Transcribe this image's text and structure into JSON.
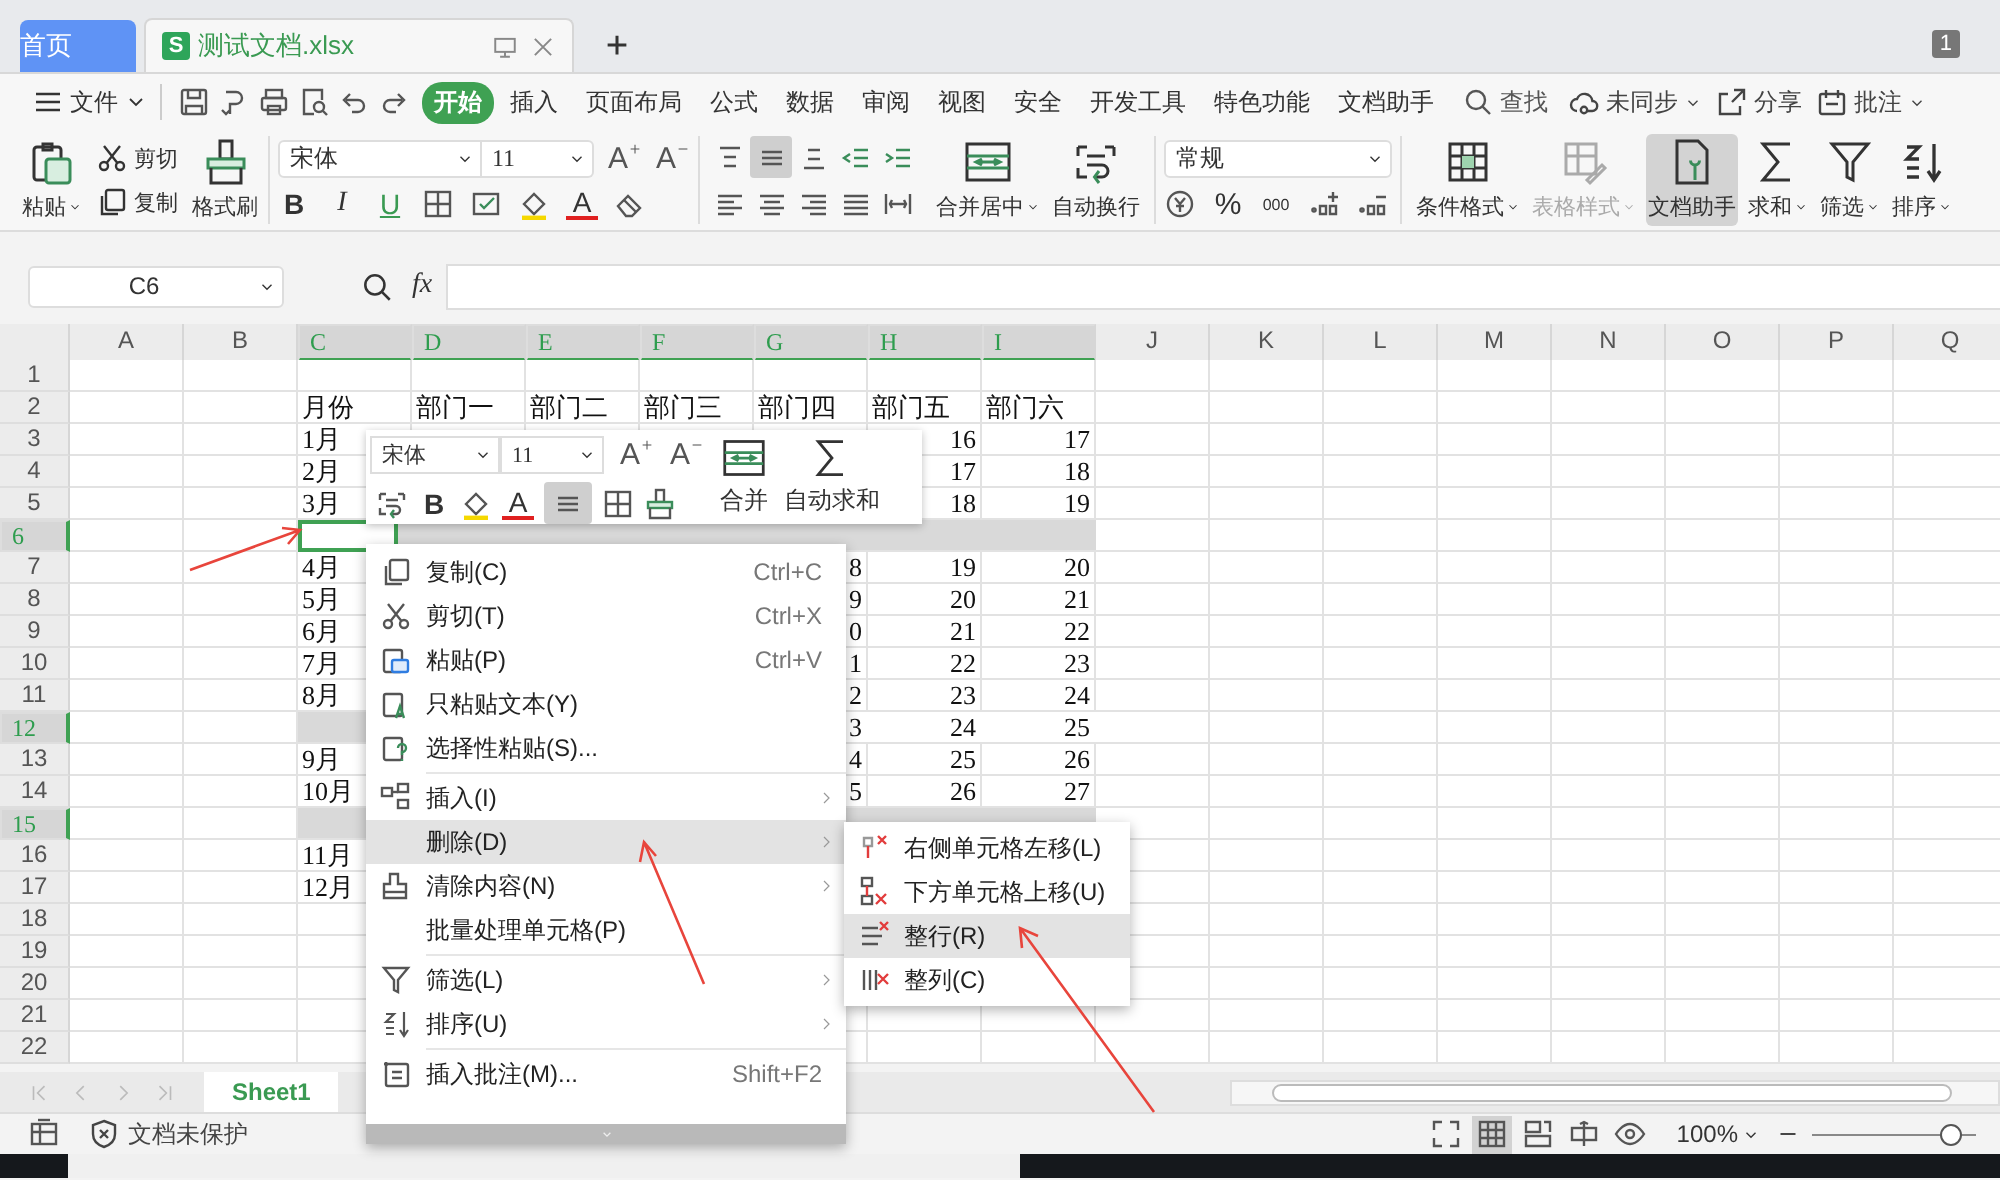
{
  "tabs": [
    {
      "kind": "home",
      "label": "首页",
      "selected": false
    },
    {
      "kind": "document",
      "label": "测试文档.xlsx",
      "icon_text": "S",
      "selected": true
    }
  ],
  "window_badge": "1",
  "menu": {
    "file": "文件",
    "tabs": [
      {
        "label": "开始",
        "selected": true
      },
      {
        "label": "插入",
        "selected": false
      },
      {
        "label": "页面布局",
        "selected": false
      },
      {
        "label": "公式",
        "selected": false
      },
      {
        "label": "数据",
        "selected": false
      },
      {
        "label": "审阅",
        "selected": false
      },
      {
        "label": "视图",
        "selected": false
      },
      {
        "label": "安全",
        "selected": false
      },
      {
        "label": "开发工具",
        "selected": false
      },
      {
        "label": "特色功能",
        "selected": false
      },
      {
        "label": "文档助手",
        "selected": false
      }
    ],
    "search": "查找",
    "actions": [
      {
        "kind": "sync",
        "label": "未同步",
        "dropdown": true
      },
      {
        "kind": "share",
        "label": "分享",
        "dropdown": false
      },
      {
        "kind": "comment",
        "label": "批注",
        "dropdown": true
      }
    ]
  },
  "ribbon": {
    "paste": "粘贴",
    "cut": "剪切",
    "copy": "复制",
    "format_painter": "格式刷",
    "font": "宋体",
    "font_size": "11",
    "grow_font": "A",
    "shrink_font": "A",
    "bold": "B",
    "italic": "I",
    "underline": "U",
    "font_color": "A",
    "alignment": [
      {
        "kind": "top",
        "selected": false
      },
      {
        "kind": "middle",
        "selected": true
      },
      {
        "kind": "bottom",
        "selected": false
      },
      {
        "kind": "outdent",
        "selected": false
      },
      {
        "kind": "indent",
        "selected": false
      },
      {
        "kind": "left",
        "selected": false
      },
      {
        "kind": "center",
        "selected": false
      },
      {
        "kind": "right",
        "selected": false
      },
      {
        "kind": "justify",
        "selected": false
      },
      {
        "kind": "distribute",
        "selected": false
      }
    ],
    "merge_buttons": [
      {
        "kind": "merge",
        "label": "合并居中",
        "dropdown": true,
        "disabled": false,
        "selected": false
      },
      {
        "kind": "wrap",
        "label": "自动换行",
        "dropdown": false,
        "disabled": false,
        "selected": false
      }
    ],
    "number_format": "常规",
    "percent": "%",
    "thousands": "000",
    "tool_buttons": [
      {
        "kind": "conditional",
        "label": "条件格式",
        "dropdown": true,
        "disabled": false,
        "selected": false
      },
      {
        "kind": "table-style",
        "label": "表格样式",
        "dropdown": true,
        "disabled": true,
        "selected": false
      },
      {
        "kind": "assistant",
        "label": "文档助手",
        "dropdown": false,
        "disabled": false,
        "selected": true
      },
      {
        "kind": "sum",
        "label": "求和",
        "dropdown": true,
        "disabled": false,
        "selected": false
      },
      {
        "kind": "filter",
        "label": "筛选",
        "dropdown": true,
        "disabled": false,
        "selected": false
      },
      {
        "kind": "sort",
        "label": "排序",
        "dropdown": true,
        "disabled": false,
        "selected": false
      }
    ]
  },
  "name_box": "C6",
  "formula_label": "fx",
  "sheet": {
    "columns": [
      {
        "label": "A",
        "selected": false
      },
      {
        "label": "B",
        "selected": false
      },
      {
        "label": "C",
        "selected": true
      },
      {
        "label": "D",
        "selected": true
      },
      {
        "label": "E",
        "selected": true
      },
      {
        "label": "F",
        "selected": true
      },
      {
        "label": "G",
        "selected": true
      },
      {
        "label": "H",
        "selected": true
      },
      {
        "label": "I",
        "selected": true
      },
      {
        "label": "J",
        "selected": false
      },
      {
        "label": "K",
        "selected": false
      },
      {
        "label": "L",
        "selected": false
      },
      {
        "label": "M",
        "selected": false
      },
      {
        "label": "N",
        "selected": false
      },
      {
        "label": "O",
        "selected": false
      },
      {
        "label": "P",
        "selected": false
      },
      {
        "label": "Q",
        "selected": false
      }
    ],
    "rows": [
      {
        "label": "1",
        "selected": false
      },
      {
        "label": "2",
        "selected": false,
        "cells": [
          {
            "kind": "text",
            "text": "月份"
          },
          {
            "kind": "text",
            "text": "部门一"
          },
          {
            "kind": "text",
            "text": "部门二"
          },
          {
            "kind": "text",
            "text": "部门三"
          },
          {
            "kind": "text",
            "text": "部门四"
          },
          {
            "kind": "text",
            "text": "部门五"
          },
          {
            "kind": "text",
            "text": "部门六"
          }
        ]
      },
      {
        "label": "3",
        "selected": false,
        "cells": [
          {
            "kind": "text",
            "text": "1月"
          },
          {},
          {},
          {},
          {},
          {
            "kind": "number",
            "text": "16"
          },
          {
            "kind": "number",
            "text": "17"
          }
        ]
      },
      {
        "label": "4",
        "selected": false,
        "cells": [
          {
            "kind": "text",
            "text": "2月"
          },
          {},
          {},
          {},
          {},
          {
            "kind": "number",
            "text": "17"
          },
          {
            "kind": "number",
            "text": "18"
          }
        ]
      },
      {
        "label": "5",
        "selected": false,
        "cells": [
          {
            "kind": "text",
            "text": "3月"
          },
          {},
          {},
          {},
          {},
          {
            "kind": "number",
            "text": "18"
          },
          {
            "kind": "number",
            "text": "19"
          }
        ]
      },
      {
        "label": "6",
        "selected": true,
        "cells": [
          {
            "active": true
          }
        ]
      },
      {
        "label": "7",
        "selected": false,
        "cells": [
          {
            "kind": "text",
            "text": "4月"
          },
          {},
          {},
          {},
          {
            "kind": "number",
            "text": "8"
          },
          {
            "kind": "number",
            "text": "19"
          },
          {
            "kind": "number",
            "text": "20"
          }
        ]
      },
      {
        "label": "8",
        "selected": false,
        "cells": [
          {
            "kind": "text",
            "text": "5月"
          },
          {},
          {},
          {},
          {
            "kind": "number",
            "text": "9"
          },
          {
            "kind": "number",
            "text": "20"
          },
          {
            "kind": "number",
            "text": "21"
          }
        ]
      },
      {
        "label": "9",
        "selected": false,
        "cells": [
          {
            "kind": "text",
            "text": "6月"
          },
          {},
          {},
          {},
          {
            "kind": "number",
            "text": "0"
          },
          {
            "kind": "number",
            "text": "21"
          },
          {
            "kind": "number",
            "text": "22"
          }
        ]
      },
      {
        "label": "10",
        "selected": false,
        "cells": [
          {
            "kind": "text",
            "text": "7月"
          },
          {},
          {},
          {},
          {
            "kind": "number",
            "text": "1"
          },
          {
            "kind": "number",
            "text": "22"
          },
          {
            "kind": "number",
            "text": "23"
          }
        ]
      },
      {
        "label": "11",
        "selected": false,
        "cells": [
          {
            "kind": "text",
            "text": "8月"
          },
          {},
          {},
          {},
          {
            "kind": "number",
            "text": "2"
          },
          {
            "kind": "number",
            "text": "23"
          },
          {
            "kind": "number",
            "text": "24"
          }
        ]
      },
      {
        "label": "12",
        "selected": true,
        "cells": [
          {},
          {},
          {},
          {},
          {
            "kind": "number",
            "text": "3"
          },
          {
            "kind": "number",
            "text": "24"
          },
          {
            "kind": "number",
            "text": "25"
          }
        ]
      },
      {
        "label": "13",
        "selected": false,
        "cells": [
          {
            "kind": "text",
            "text": "9月"
          },
          {},
          {},
          {},
          {
            "kind": "number",
            "text": "4"
          },
          {
            "kind": "number",
            "text": "25"
          },
          {
            "kind": "number",
            "text": "26"
          }
        ]
      },
      {
        "label": "14",
        "selected": false,
        "cells": [
          {
            "kind": "text",
            "text": "10月"
          },
          {},
          {},
          {},
          {
            "kind": "number",
            "text": "5"
          },
          {
            "kind": "number",
            "text": "26"
          },
          {
            "kind": "number",
            "text": "27"
          }
        ]
      },
      {
        "label": "15",
        "selected": true
      },
      {
        "label": "16",
        "selected": false,
        "cells": [
          {
            "kind": "text",
            "text": "11月"
          }
        ]
      },
      {
        "label": "17",
        "selected": false,
        "cells": [
          {
            "kind": "text",
            "text": "12月"
          }
        ]
      },
      {
        "label": "18",
        "selected": false
      },
      {
        "label": "19",
        "selected": false
      },
      {
        "label": "20",
        "selected": false
      },
      {
        "label": "21",
        "selected": false
      },
      {
        "label": "22",
        "selected": false
      }
    ]
  },
  "mini_toolbar": {
    "font": "宋体",
    "font_size": "11",
    "grow_font": "A",
    "shrink_font": "A",
    "bold": "B",
    "font_color": "A",
    "merge": "合并",
    "autosum": "自动求和"
  },
  "context_menu": {
    "groups": [
      [
        {
          "kind": "copy",
          "label": "复制(C)",
          "shortcut": "Ctrl+C",
          "submenu": false,
          "selected": false
        },
        {
          "kind": "cut",
          "label": "剪切(T)",
          "shortcut": "Ctrl+X",
          "submenu": false,
          "selected": false
        },
        {
          "kind": "paste",
          "label": "粘贴(P)",
          "shortcut": "Ctrl+V",
          "submenu": false,
          "selected": false
        },
        {
          "kind": "paste-text",
          "label": "只粘贴文本(Y)",
          "submenu": false,
          "selected": false
        },
        {
          "kind": "paste-special",
          "label": "选择性粘贴(S)...",
          "submenu": false,
          "selected": false
        }
      ],
      [
        {
          "kind": "insert",
          "label": "插入(I)",
          "submenu": true,
          "selected": false
        },
        {
          "kind": "delete",
          "label": "删除(D)",
          "submenu": true,
          "selected": true
        },
        {
          "kind": "clear",
          "label": "清除内容(N)",
          "submenu": true,
          "selected": false
        },
        {
          "kind": "batch",
          "label": "批量处理单元格(P)",
          "submenu": false,
          "selected": false
        }
      ],
      [
        {
          "kind": "filter",
          "label": "筛选(L)",
          "submenu": true,
          "selected": false
        },
        {
          "kind": "sort",
          "label": "排序(U)",
          "submenu": true,
          "selected": false
        }
      ],
      [
        {
          "kind": "comment",
          "label": "插入批注(M)...",
          "shortcut": "Shift+F2",
          "submenu": false,
          "selected": false
        }
      ]
    ]
  },
  "submenu": {
    "items": [
      {
        "kind": "shift-left",
        "label": "右侧单元格左移(L)",
        "selected": false
      },
      {
        "kind": "shift-up",
        "label": "下方单元格上移(U)",
        "selected": false
      },
      {
        "kind": "row",
        "label": "整行(R)",
        "selected": true
      },
      {
        "kind": "column",
        "label": "整列(C)",
        "selected": false
      }
    ]
  },
  "sheet_tabs": [
    {
      "label": "Sheet1",
      "selected": true
    }
  ],
  "status_bar": {
    "protection": "文档未保护",
    "views": [
      {
        "kind": "fullscreen",
        "selected": false
      },
      {
        "kind": "normal",
        "selected": true
      },
      {
        "kind": "page-break",
        "selected": false
      },
      {
        "kind": "reading",
        "selected": false
      },
      {
        "kind": "eye",
        "selected": false
      }
    ],
    "zoom": "100%",
    "zoom_slider": {
      "level": 0.9
    }
  }
}
